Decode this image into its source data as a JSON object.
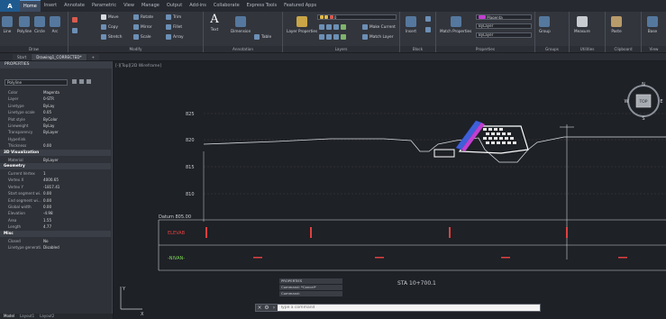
{
  "app_icon": "A",
  "ribbon_tabs": [
    "Home",
    "Insert",
    "Annotate",
    "Parametric",
    "View",
    "Manage",
    "Output",
    "Add-ins",
    "Collaborate",
    "Express Tools",
    "Featured Apps"
  ],
  "ribbon": {
    "draw": {
      "title": "Draw",
      "line": "Line",
      "polyline": "Polyline",
      "circle": "Circle",
      "arc": "Arc"
    },
    "modify": {
      "title": "Modify",
      "move": "Move",
      "rotate": "Rotate",
      "trim": "Trim",
      "copy": "Copy",
      "mirror": "Mirror",
      "fillet": "Fillet",
      "stretch": "Stretch",
      "scale": "Scale",
      "array": "Array"
    },
    "annotation": {
      "title": "Annotation",
      "text": "Text",
      "dimension": "Dimension",
      "table": "Table"
    },
    "layers": {
      "title": "Layers",
      "layer_properties": "Layer Properties",
      "current_layer": "0",
      "make_current": "Make Current",
      "match_layer": "Match Layer"
    },
    "block": {
      "title": "Block",
      "insert": "Insert"
    },
    "properties": {
      "title": "Properties",
      "match": "Match Properties",
      "color": "Magenta",
      "linetype": "ByLayer",
      "lineweight": "ByLayer"
    },
    "groups": {
      "title": "Groups",
      "group": "Group"
    },
    "utilities": {
      "title": "Utilities",
      "measure": "Measure"
    },
    "clipboard": {
      "title": "Clipboard",
      "paste": "Paste"
    },
    "view": {
      "title": "View",
      "base": "Base"
    }
  },
  "doc_tabs": [
    "Start",
    "Drawing1_CORRECTED*",
    "+"
  ],
  "properties": {
    "header": "PROPERTIES",
    "object_type": "Polyline",
    "general": [
      {
        "k": "Color",
        "v": "Magenta"
      },
      {
        "k": "Layer",
        "v": "0-STR"
      },
      {
        "k": "Linetype",
        "v": "ByLay"
      },
      {
        "k": "Linetype scale",
        "v": "0.05"
      },
      {
        "k": "Plot style",
        "v": "ByColor"
      },
      {
        "k": "Lineweight",
        "v": "ByLay"
      },
      {
        "k": "Transparency",
        "v": "ByLayer"
      },
      {
        "k": "Hyperlink",
        "v": ""
      },
      {
        "k": "Thickness",
        "v": "0.00"
      }
    ],
    "sec_3d": "3D Visualization",
    "viz": [
      {
        "k": "Material",
        "v": "ByLayer"
      }
    ],
    "sec_geometry": "Geometry",
    "geometry": [
      {
        "k": "Current Vertex",
        "v": "1"
      },
      {
        "k": "Vertex X",
        "v": "4000.65"
      },
      {
        "k": "Vertex Y",
        "v": "-1817.41"
      },
      {
        "k": "Start segment wi...",
        "v": "0.00"
      },
      {
        "k": "End segment wi...",
        "v": "0.00"
      },
      {
        "k": "Global width",
        "v": "0.00"
      },
      {
        "k": "Elevation",
        "v": "-4.98"
      },
      {
        "k": "Area",
        "v": "1.55"
      },
      {
        "k": "Length",
        "v": "4.77"
      }
    ],
    "sec_misc": "Misc",
    "misc": [
      {
        "k": "Closed",
        "v": "No"
      },
      {
        "k": "Linetype generati...",
        "v": "Disabled"
      }
    ],
    "bottom_tabs": [
      "Model",
      "Layout1",
      "Layout2"
    ]
  },
  "canvas": {
    "viewport_label": "[-][Top][2D Wireframe]",
    "elev_labels": [
      "825",
      "820",
      "815",
      "810"
    ],
    "datum": "Datum 805.00",
    "row_labels": [
      "ELEVAB",
      "-NIVAN-"
    ],
    "station": "STA 10+700.1",
    "compass": {
      "n": "N",
      "s": "S",
      "e": "E",
      "w": "W",
      "top": "TOP"
    }
  },
  "command": {
    "history": [
      "PROPERTIES",
      "Command: *Cancel*",
      "Command:"
    ],
    "placeholder": "Type a command"
  },
  "colors": {
    "accent": "#5e9ad6",
    "magenta": "#c23fd0",
    "red": "#e04040",
    "green": "#7ed957",
    "bg": "#1e2126"
  }
}
